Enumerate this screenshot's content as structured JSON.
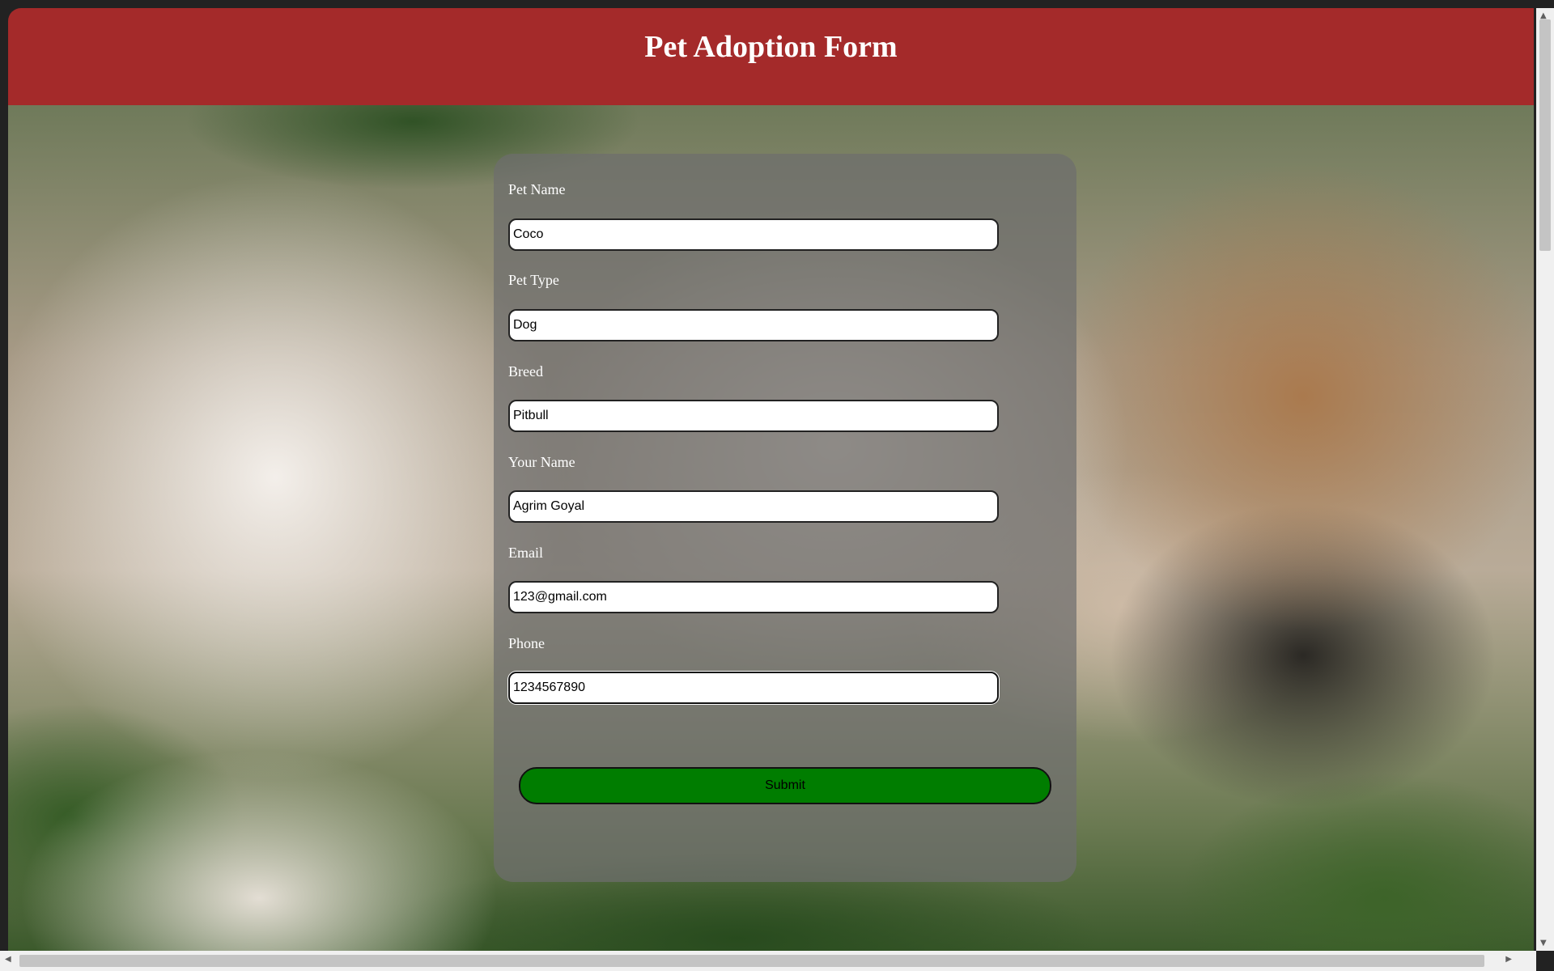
{
  "header": {
    "title": "Pet Adoption Form"
  },
  "form": {
    "fields": [
      {
        "label": "Pet Name",
        "value": "Coco"
      },
      {
        "label": "Pet Type",
        "value": "Dog"
      },
      {
        "label": "Breed",
        "value": "Pitbull"
      },
      {
        "label": "Your Name",
        "value": "Agrim Goyal"
      },
      {
        "label": "Email",
        "value": "123@gmail.com"
      },
      {
        "label": "Phone",
        "value": "1234567890"
      }
    ],
    "submit_label": "Submit"
  },
  "colors": {
    "header_bg": "#a42a2a",
    "submit_bg": "#007d00",
    "card_bg": "rgba(110,110,110,0.72)"
  },
  "icons": {
    "scroll_up": "triangle-up",
    "scroll_down": "triangle-down",
    "scroll_left": "triangle-left",
    "scroll_right": "triangle-right"
  }
}
